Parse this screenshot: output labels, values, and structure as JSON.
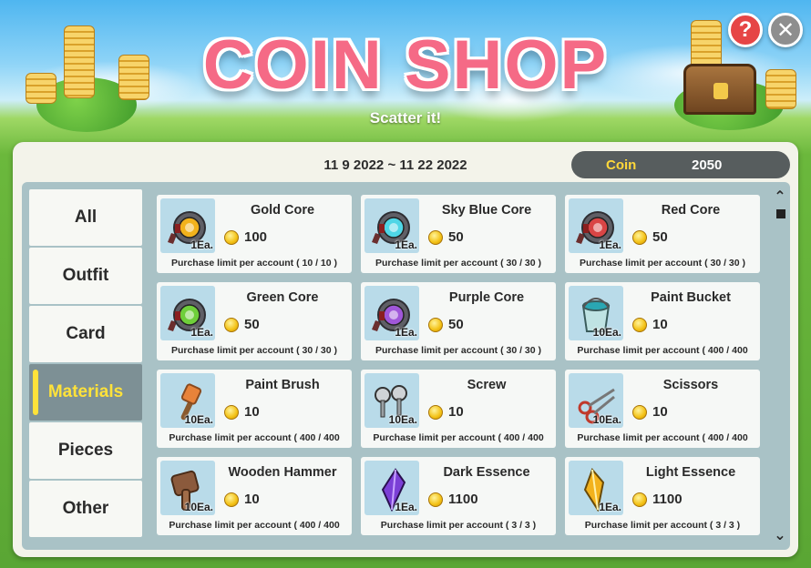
{
  "header": {
    "title": "COIN SHOP",
    "subtitle": "Scatter it!",
    "help_label": "?",
    "close_label": "✕"
  },
  "event": {
    "date_range": "11 9 2022 ~ 11 22 2022"
  },
  "wallet": {
    "label": "Coin",
    "value": "2050"
  },
  "colors": {
    "title_pink": "#f56a86",
    "active_tab_text": "#ffe23a",
    "help_button": "#e64545",
    "close_button": "#8e8e8e"
  },
  "sidebar": {
    "tabs": [
      {
        "label": "All",
        "active": false
      },
      {
        "label": "Outfit",
        "active": false
      },
      {
        "label": "Card",
        "active": false
      },
      {
        "label": "Materials",
        "active": true
      },
      {
        "label": "Pieces",
        "active": false
      },
      {
        "label": "Other",
        "active": false
      }
    ]
  },
  "items": [
    {
      "name": "Gold Core",
      "qty": "1Ea.",
      "price": "100",
      "limit": "Purchase limit per account ( 10 / 10 )",
      "icon": "gold-core-icon"
    },
    {
      "name": "Sky Blue Core",
      "qty": "1Ea.",
      "price": "50",
      "limit": "Purchase limit per account ( 30 / 30 )",
      "icon": "sky-blue-core-icon"
    },
    {
      "name": "Red Core",
      "qty": "1Ea.",
      "price": "50",
      "limit": "Purchase limit per account ( 30 / 30 )",
      "icon": "red-core-icon"
    },
    {
      "name": "Green Core",
      "qty": "1Ea.",
      "price": "50",
      "limit": "Purchase limit per account ( 30 / 30 )",
      "icon": "green-core-icon"
    },
    {
      "name": "Purple Core",
      "qty": "1Ea.",
      "price": "50",
      "limit": "Purchase limit per account ( 30 / 30 )",
      "icon": "purple-core-icon"
    },
    {
      "name": "Paint Bucket",
      "qty": "10Ea.",
      "price": "10",
      "limit": "Purchase limit per account ( 400 / 400",
      "icon": "paint-bucket-icon"
    },
    {
      "name": "Paint Brush",
      "qty": "10Ea.",
      "price": "10",
      "limit": "Purchase limit per account ( 400 / 400",
      "icon": "paint-brush-icon"
    },
    {
      "name": "Screw",
      "qty": "10Ea.",
      "price": "10",
      "limit": "Purchase limit per account ( 400 / 400",
      "icon": "screw-icon"
    },
    {
      "name": "Scissors",
      "qty": "10Ea.",
      "price": "10",
      "limit": "Purchase limit per account ( 400 / 400",
      "icon": "scissors-icon"
    },
    {
      "name": "Wooden Hammer",
      "qty": "10Ea.",
      "price": "10",
      "limit": "Purchase limit per account ( 400 / 400",
      "icon": "wooden-hammer-icon"
    },
    {
      "name": "Dark Essence",
      "qty": "1Ea.",
      "price": "1100",
      "limit": "Purchase limit per account ( 3 / 3 )",
      "icon": "dark-essence-icon"
    },
    {
      "name": "Light Essence",
      "qty": "1Ea.",
      "price": "1100",
      "limit": "Purchase limit per account ( 3 / 3 )",
      "icon": "light-essence-icon"
    }
  ],
  "scrollbar": {
    "up_glyph": "⌃",
    "down_glyph": "⌄"
  }
}
